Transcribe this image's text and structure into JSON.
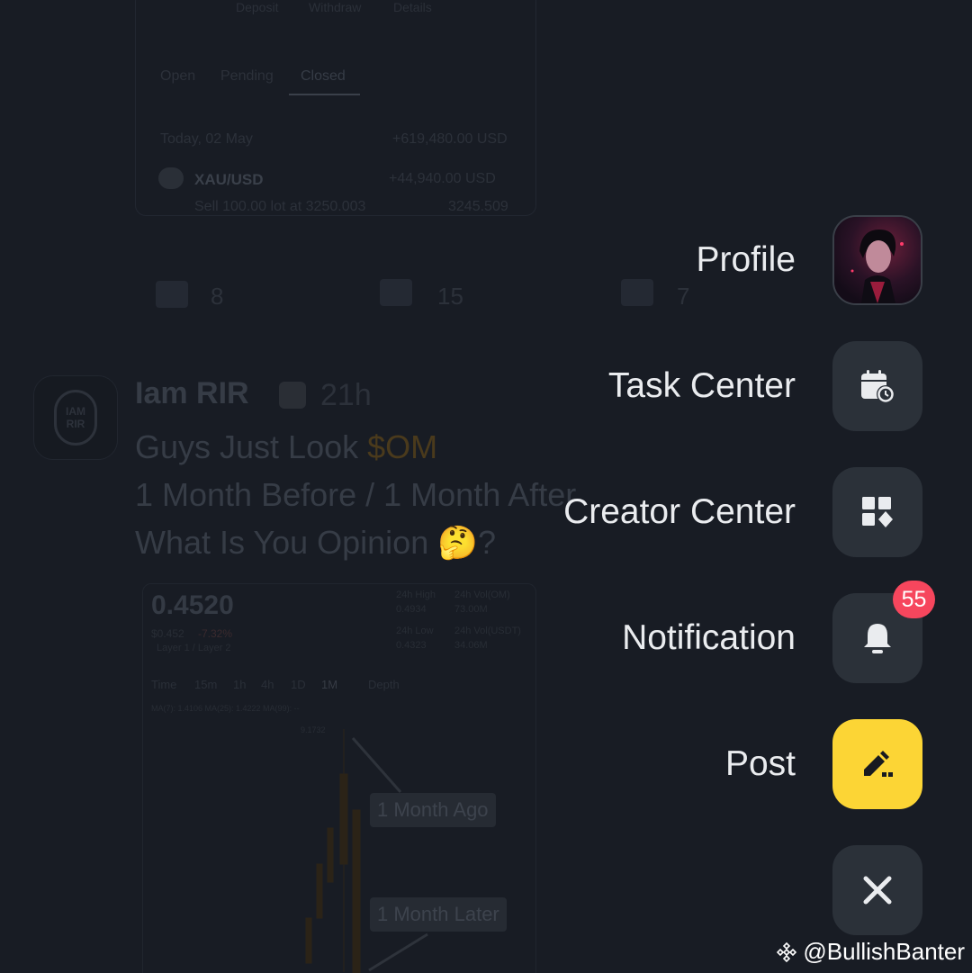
{
  "background": {
    "account_tabs": [
      "Deposit",
      "Withdraw",
      "Details"
    ],
    "order_tabs": [
      "Open",
      "Pending",
      "Closed"
    ],
    "closed_positions": {
      "date": "Today, 02 May",
      "total": "+619,480.00 USD",
      "symbol": "XAU/USD",
      "pnl": "+44,940.00 USD",
      "detail_prefix": "Sell 100.00 lot",
      "detail_at": "at",
      "entry_price": "3250.003",
      "close_price": "3245.509"
    },
    "stats": {
      "comments": "8",
      "likes": "15",
      "reposts": "7"
    },
    "post": {
      "avatar_line1": "IAM",
      "avatar_line2": "RIR",
      "author": "Iam RIR",
      "time": "21h",
      "line1_prefix": "Guys Just Look ",
      "ticker": "$OM",
      "line2": "1 Month Before / 1 Month After",
      "line3": "What Is You Opinion 🤔?"
    },
    "chart": {
      "price": "0.4520",
      "price_usd": "$0.452",
      "change": "-7.32%",
      "layer": "Layer 1 / Layer 2",
      "high_label": "24h High",
      "high_value": "0.4934",
      "vol_om_label": "24h Vol(OM)",
      "vol_om_value": "73.00M",
      "low_label": "24h Low",
      "low_value": "0.4323",
      "vol_usdt_label": "24h Vol(USDT)",
      "vol_usdt_value": "34.06M",
      "intervals": [
        "Time",
        "15m",
        "1h",
        "4h",
        "1D",
        "1M",
        "Depth"
      ],
      "ma_text": "MA(7): 1.4106   MA(25): 1.4222   MA(99): --",
      "peak_label": "9.1732",
      "callout_ago": "1 Month Ago",
      "callout_later": "1 Month Later"
    }
  },
  "menu": {
    "items": [
      {
        "label": "Profile",
        "icon": "profile-avatar"
      },
      {
        "label": "Task Center",
        "icon": "calendar-clock-icon"
      },
      {
        "label": "Creator Center",
        "icon": "grid-diamond-icon"
      },
      {
        "label": "Notification",
        "icon": "bell-icon",
        "badge": "55"
      },
      {
        "label": "Post",
        "icon": "pen-edit-icon"
      }
    ],
    "close_icon": "close-icon"
  },
  "watermark": "@BullishBanter",
  "colors": {
    "accent": "#fcd535",
    "badge": "#f6465d",
    "button_bg": "#2b3139",
    "page_bg": "#181c24"
  }
}
